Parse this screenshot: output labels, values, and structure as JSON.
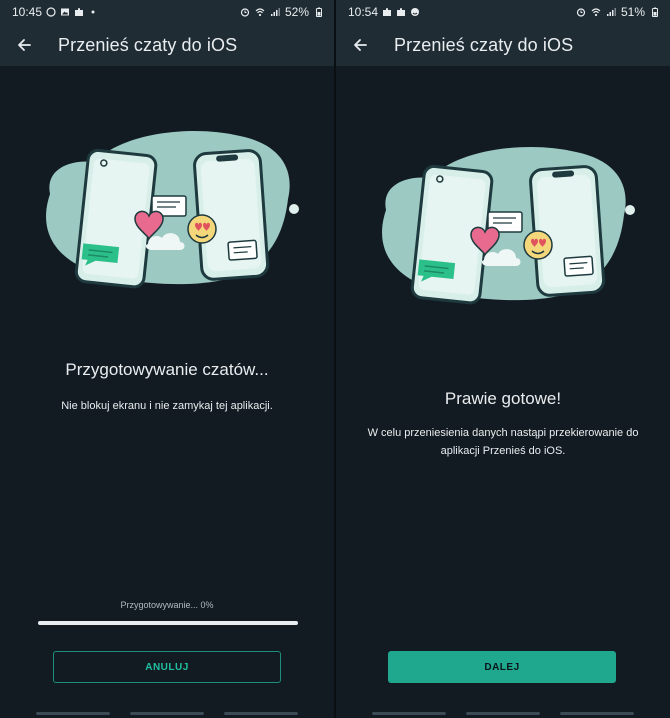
{
  "colors": {
    "background": "#121b22",
    "appbar": "#1f2c34",
    "accent": "#1fa88d",
    "text": "#e9edef",
    "muted": "#aebac1"
  },
  "left": {
    "status": {
      "time": "10:45",
      "battery": "52%",
      "icons_left": [
        "whatsapp-icon",
        "gallery-icon",
        "puzzle-icon",
        "dot-icon"
      ],
      "icons_right": [
        "alarm-icon",
        "wifi-icon",
        "signal-icon",
        "battery-icon"
      ]
    },
    "title": "Przenieś czaty do iOS",
    "heading": "Przygotowywanie czatów...",
    "description": "Nie blokuj ekranu i nie zamykaj tej aplikacji.",
    "progress_label": "Przygotowywanie... 0%",
    "progress_value": 0,
    "button_label": "ANULUJ"
  },
  "right": {
    "status": {
      "time": "10:54",
      "battery": "51%",
      "icons_left": [
        "puzzle-icon",
        "puzzle-icon",
        "emoji-icon"
      ],
      "icons_right": [
        "alarm-icon",
        "wifi-icon",
        "signal-icon",
        "battery-icon"
      ]
    },
    "title": "Przenieś czaty do iOS",
    "heading": "Prawie gotowe!",
    "description": "W celu przeniesienia danych nastąpi przekierowanie do aplikacji Przenieś do iOS.",
    "button_label": "DALEJ"
  }
}
